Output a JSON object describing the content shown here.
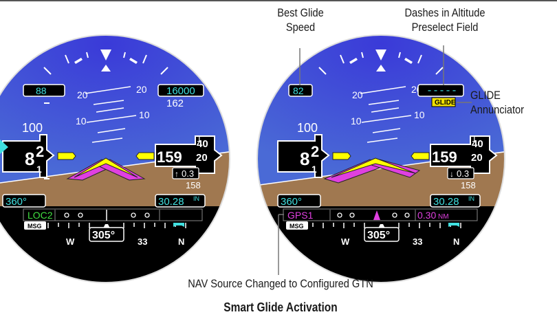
{
  "callouts": {
    "best_glide_line1": "Best Glide",
    "best_glide_line2": "Speed",
    "dashes_line1": "Dashes in Altitude",
    "dashes_line2": "Preselect Field",
    "glide_line1": "GLIDE",
    "glide_line2": "Annunciator",
    "nav_source": "NAV Source Changed to Configured GTN"
  },
  "caption": "Smart Glide Activation",
  "displays": {
    "before": {
      "speed_bug": "88",
      "speed_tape_label": "100",
      "speed_hundreds": "8",
      "speed_tens": "2",
      "speed_low": "1",
      "altitude_preselect": "16000",
      "altitude_tape_upper": "162",
      "altitude_main": "159",
      "altitude_tens": "20",
      "altitude_upper_digit": "40",
      "altitude_lower_digit": "1",
      "vsi_value": "0.3",
      "vsi_arrow": "↑",
      "altitude_tape_lower": "158",
      "pitch_20": "20",
      "pitch_10": "10",
      "heading_bug": "360°",
      "baro": "30.28",
      "baro_unit": "IN",
      "nav_source": "LOC2",
      "heading": "305°",
      "compass_w": "W",
      "compass_33": "33",
      "compass_n": "N",
      "msg": "MSG"
    },
    "after": {
      "speed_bug": "82",
      "speed_tape_label": "100",
      "speed_hundreds": "8",
      "speed_tens": "2",
      "speed_low": "1",
      "altitude_preselect": "-----",
      "glide_annunciator": "GLIDE",
      "altitude_main": "159",
      "altitude_tens": "20",
      "altitude_upper_digit": "40",
      "altitude_lower_digit": "1",
      "vsi_value": "0.3",
      "vsi_arrow": "↓",
      "altitude_tape_lower": "158",
      "pitch_20": "20",
      "pitch_10": "10",
      "heading_bug": "360°",
      "baro": "30.28",
      "baro_unit": "IN",
      "nav_source": "GPS1",
      "distance": "0.30",
      "distance_unit": "NM",
      "heading": "305°",
      "compass_w": "W",
      "compass_33": "33",
      "compass_n": "N",
      "msg": "MSG"
    }
  },
  "colors": {
    "sky": "#3c3cd8",
    "ground": "#a07850",
    "cyan": "#40e0e0",
    "magenta": "#e040e0",
    "green": "#40e040",
    "yellow": "#ffff00",
    "glide_box": "#f0e000"
  }
}
